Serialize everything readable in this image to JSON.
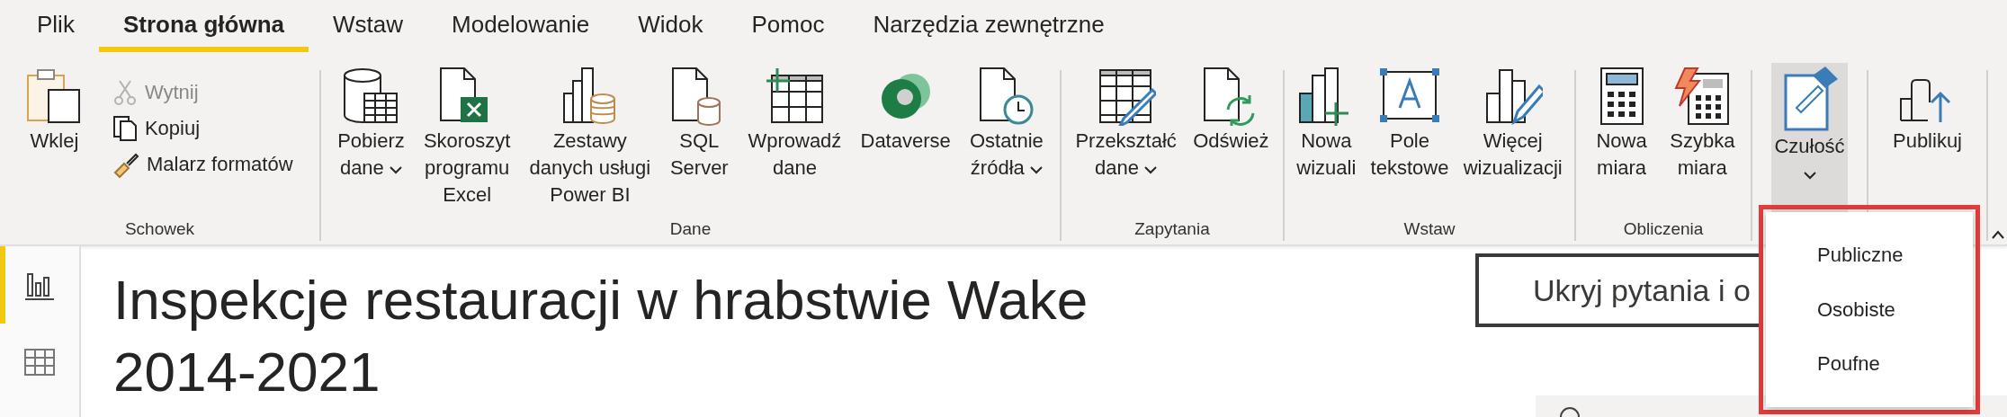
{
  "menu_tabs": [
    {
      "label": "Plik",
      "selected": false
    },
    {
      "label": "Strona główna",
      "selected": true
    },
    {
      "label": "Wstaw",
      "selected": false
    },
    {
      "label": "Modelowanie",
      "selected": false
    },
    {
      "label": "Widok",
      "selected": false
    },
    {
      "label": "Pomoc",
      "selected": false
    },
    {
      "label": "Narzędzia zewnętrzne",
      "selected": false
    }
  ],
  "ribbon": {
    "groups": [
      {
        "label": "Schowek",
        "items": [
          {
            "kind": "large",
            "label": "Wklej",
            "dropdown": false
          },
          {
            "kind": "small",
            "label": "Wytnij",
            "disabled": true
          },
          {
            "kind": "small",
            "label": "Kopiuj",
            "disabled": false
          },
          {
            "kind": "small",
            "label": "Malarz formatów",
            "disabled": false
          }
        ]
      },
      {
        "label": "Dane",
        "items": [
          {
            "kind": "large",
            "label": "Pobierz\ndane",
            "dropdown": true
          },
          {
            "kind": "large",
            "label": "Skoroszyt\nprogramu\nExcel",
            "dropdown": false
          },
          {
            "kind": "large",
            "label": "Zestawy\ndanych usługi\nPower BI",
            "dropdown": false
          },
          {
            "kind": "large",
            "label": "SQL\nServer",
            "dropdown": false
          },
          {
            "kind": "large",
            "label": "Wprowadź\ndane",
            "dropdown": false
          },
          {
            "kind": "large",
            "label": "Dataverse",
            "dropdown": false
          },
          {
            "kind": "large",
            "label": "Ostatnie\nźródła",
            "dropdown": true
          }
        ]
      },
      {
        "label": "Zapytania",
        "items": [
          {
            "kind": "large",
            "label": "Przekształć\ndane",
            "dropdown": true
          },
          {
            "kind": "large",
            "label": "Odśwież",
            "dropdown": false
          }
        ]
      },
      {
        "label": "Wstaw",
        "items": [
          {
            "kind": "large",
            "label": "Nowa\nwizuali",
            "dropdown": false
          },
          {
            "kind": "large",
            "label": "Pole\ntekstowe",
            "dropdown": false
          },
          {
            "kind": "large",
            "label": "Więcej\nwizualizacji",
            "dropdown": false
          }
        ]
      },
      {
        "label": "Obliczenia",
        "items": [
          {
            "kind": "large",
            "label": "Nowa\nmiara",
            "dropdown": false
          },
          {
            "kind": "large",
            "label": "Szybka\nmiara",
            "dropdown": false
          }
        ]
      },
      {
        "items": [
          {
            "kind": "large",
            "label": "Czułość",
            "dropdown": true,
            "selected": true
          }
        ]
      },
      {
        "items": [
          {
            "kind": "large",
            "label": "Publikuj",
            "dropdown": false
          }
        ]
      }
    ]
  },
  "sidebar": {
    "views": [
      {
        "selected": true
      },
      {
        "selected": false
      }
    ]
  },
  "report": {
    "title": "Inspekcje restauracji w hrabstwie Wake 2014-2021",
    "qa_button": "Ukryj pytania i o"
  },
  "sensitivity_menu": {
    "open": true,
    "items": [
      "Publiczne",
      "Osobiste",
      "Poufne"
    ]
  }
}
